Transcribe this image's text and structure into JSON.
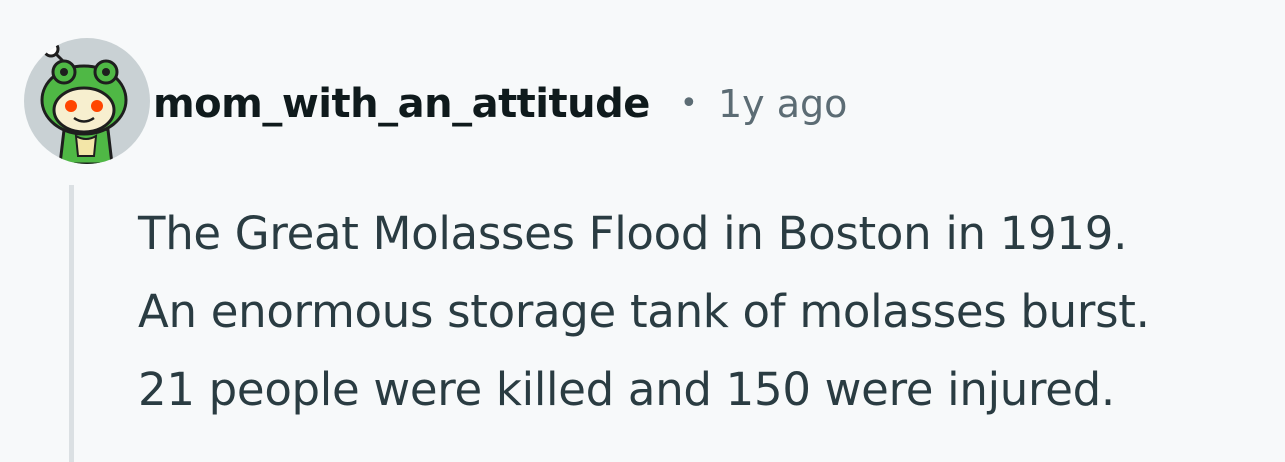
{
  "comment": {
    "author": "mom_with_an_attitude",
    "separator": "•",
    "time": "1y ago",
    "body_lines": [
      "The Great Molasses Flood in Boston in 1919.",
      "An enormous storage tank of molasses burst.",
      "21 people were killed and 150 were injured."
    ]
  },
  "colors": {
    "background": "#f7f9fa",
    "author": "#0f1a1c",
    "meta": "#5c6c74",
    "body": "#2a3c42",
    "thread_line": "#dbe0e3",
    "avatar_bg": "#c9d1d4",
    "avatar_hood": "#4fb845"
  },
  "icons": {
    "avatar": "snoo-avatar-frog-hood-icon"
  }
}
